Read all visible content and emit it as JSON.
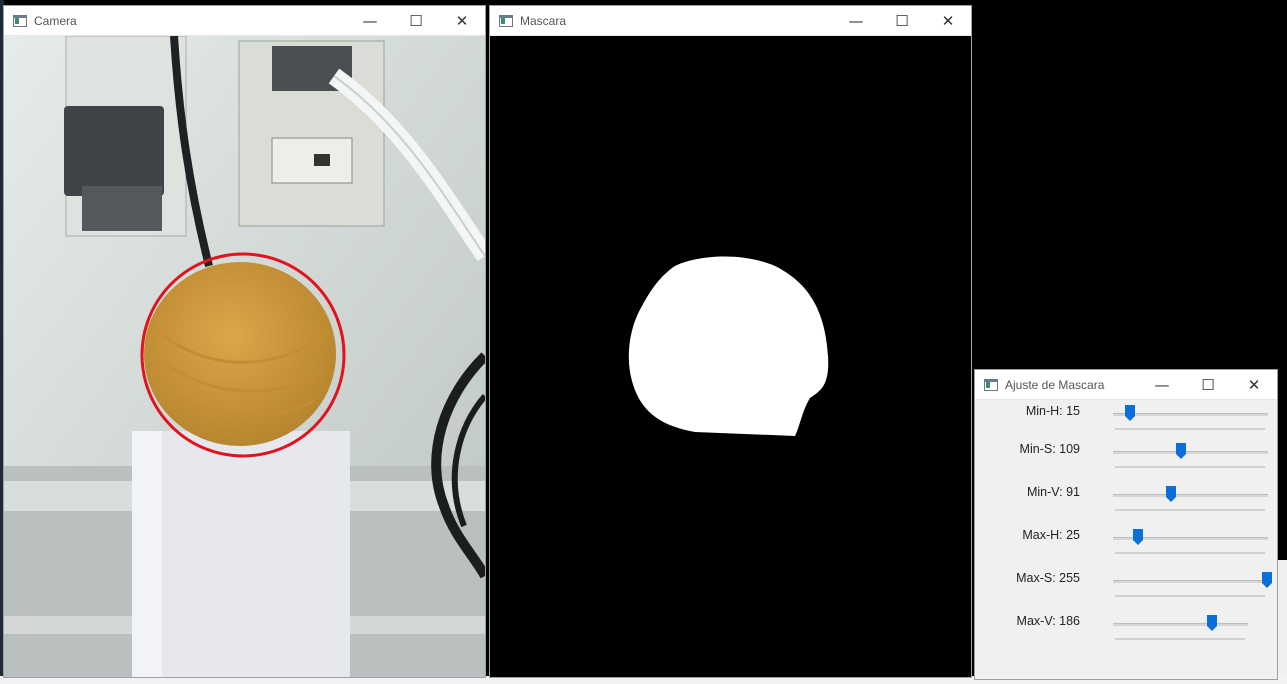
{
  "windows": {
    "camera": {
      "title": "Camera",
      "detection_circle_color": "#e0141e"
    },
    "mask": {
      "title": "Mascara"
    },
    "adjust": {
      "title": "Ajuste de Mascara",
      "sliders": [
        {
          "label": "Min-H: 15",
          "value": 15,
          "max": 179
        },
        {
          "label": "Min-S: 109",
          "value": 109,
          "max": 255
        },
        {
          "label": "Min-V: 91",
          "value": 91,
          "max": 255
        },
        {
          "label": "Max-H: 25",
          "value": 25,
          "max": 179
        },
        {
          "label": "Max-S: 255",
          "value": 255,
          "max": 255
        },
        {
          "label": "Max-V: 186",
          "value": 186,
          "max": 255
        }
      ]
    }
  },
  "controls": {
    "minimize": "—",
    "maximize": "☐",
    "close": "✕"
  },
  "colors": {
    "slider_thumb": "#0a6fd8",
    "ball": "#d39a3c"
  }
}
